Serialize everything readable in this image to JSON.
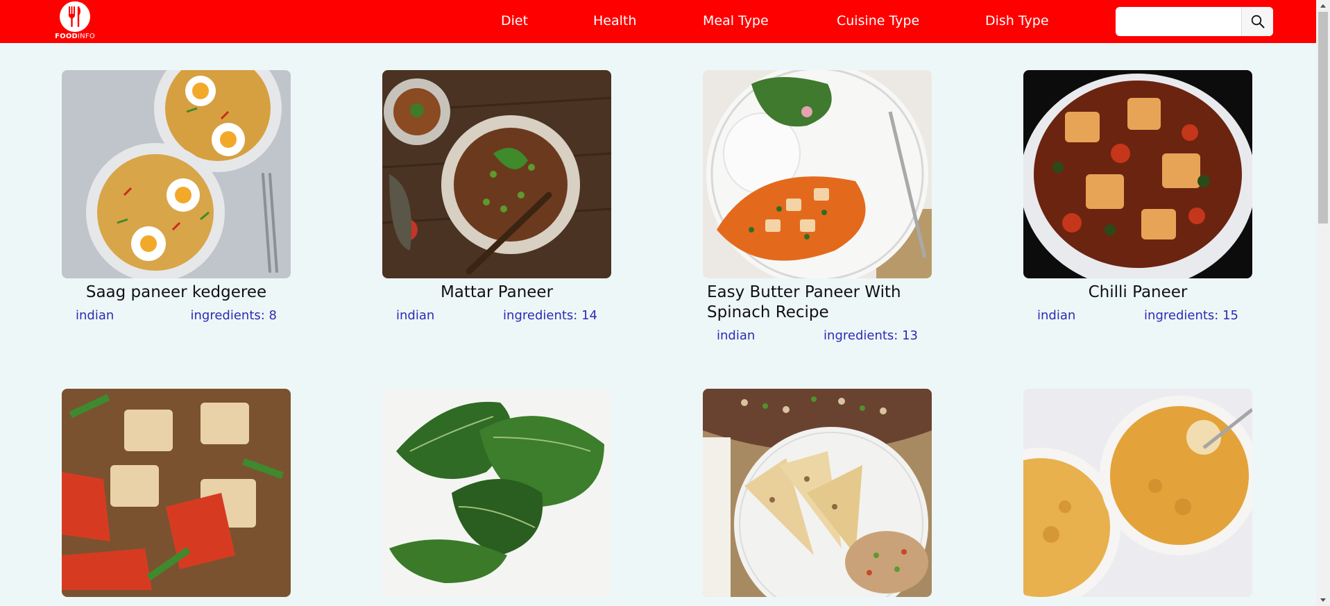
{
  "header": {
    "brand_bold": "FOOD",
    "brand_light": "INFO",
    "nav": [
      "Diet",
      "Health",
      "Meal Type",
      "Cuisine Type",
      "Dish Type"
    ],
    "search_placeholder": ""
  },
  "colors": {
    "header_bg": "#ff0000",
    "page_bg": "#eef7f8",
    "link": "#2b2bb5"
  },
  "cards": [
    {
      "title": "Saag paneer kedgeree",
      "cuisine": "indian",
      "ingredients": "ingredients: 8"
    },
    {
      "title": "Mattar Paneer",
      "cuisine": "indian",
      "ingredients": "ingredients: 14"
    },
    {
      "title": "Easy Butter Paneer With Spinach Recipe",
      "cuisine": "indian",
      "ingredients": "ingredients: 13"
    },
    {
      "title": "Chilli Paneer",
      "cuisine": "indian",
      "ingredients": "ingredients: 15"
    },
    {
      "title": "",
      "cuisine": "",
      "ingredients": ""
    },
    {
      "title": "",
      "cuisine": "",
      "ingredients": ""
    },
    {
      "title": "",
      "cuisine": "",
      "ingredients": ""
    },
    {
      "title": "",
      "cuisine": "",
      "ingredients": ""
    }
  ]
}
